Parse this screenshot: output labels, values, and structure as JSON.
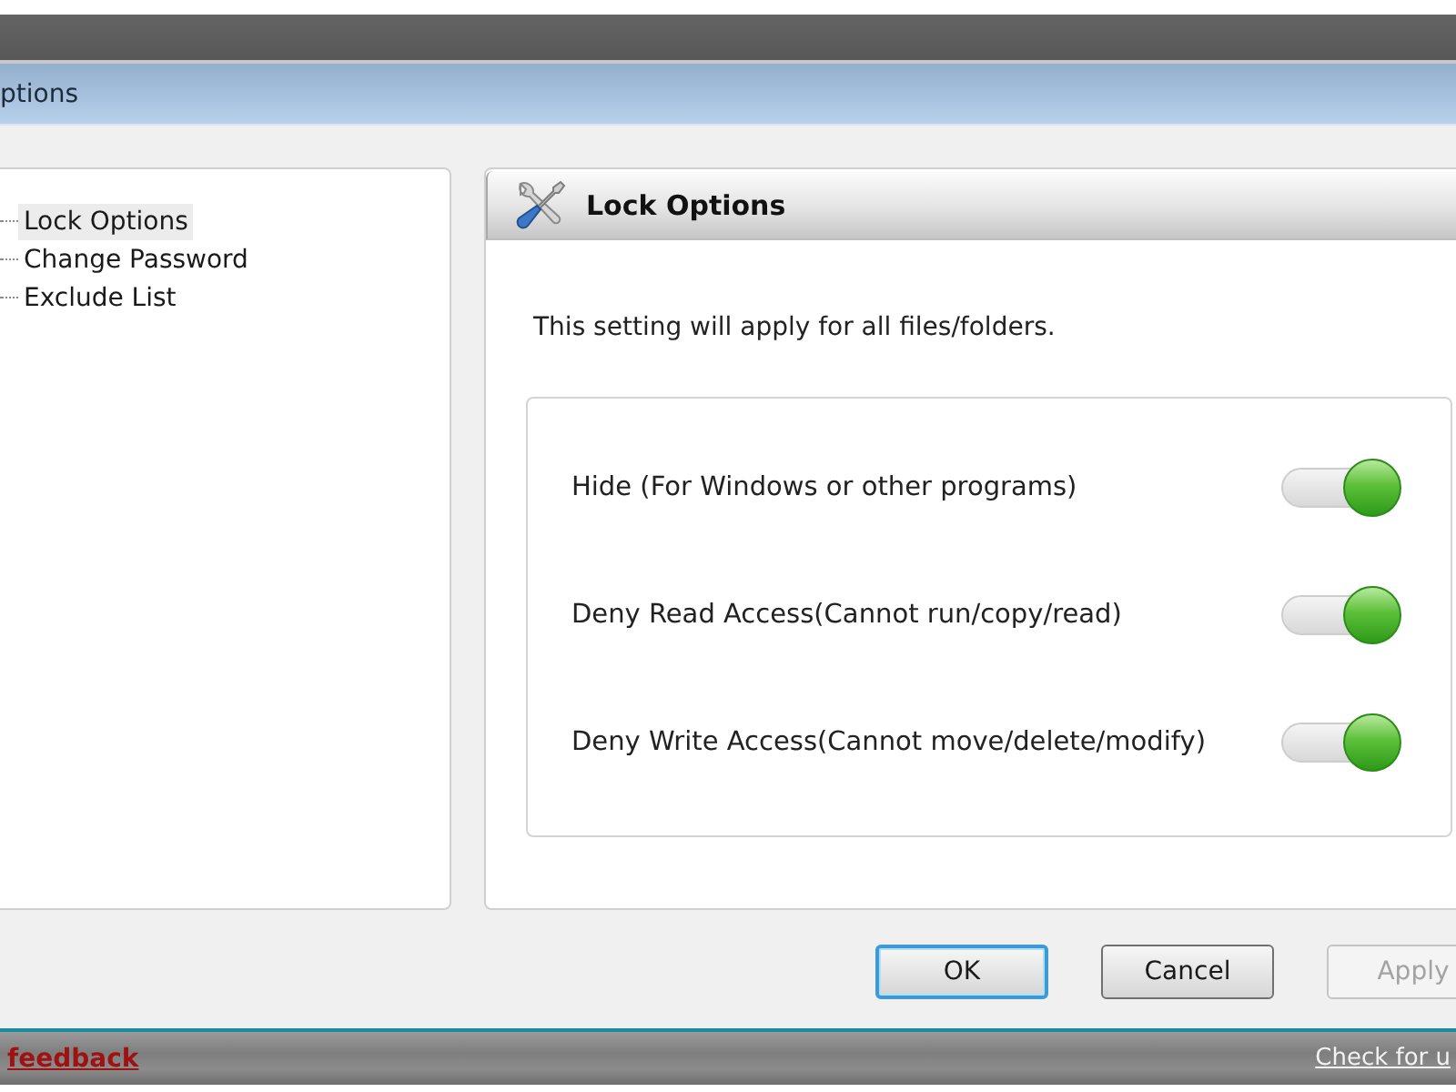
{
  "window": {
    "title": "ptions"
  },
  "sidebar": {
    "items": [
      {
        "label": "Lock Options",
        "selected": true
      },
      {
        "label": "Change Password",
        "selected": false
      },
      {
        "label": "Exclude List",
        "selected": false
      }
    ]
  },
  "panel": {
    "title": "Lock Options",
    "description": "This setting will apply for all files/folders.",
    "options": [
      {
        "label": "Hide (For Windows or other programs)",
        "on": true
      },
      {
        "label": "Deny Read Access(Cannot run/copy/read)",
        "on": true
      },
      {
        "label": "Deny Write Access(Cannot move/delete/modify)",
        "on": true
      }
    ]
  },
  "buttons": [
    {
      "label": "OK",
      "default": true,
      "disabled": false
    },
    {
      "label": "Cancel",
      "default": false,
      "disabled": false
    },
    {
      "label": "Apply",
      "default": false,
      "disabled": true
    }
  ],
  "status_bar": {
    "left_link": "feedback",
    "right_link": "Check for u"
  }
}
